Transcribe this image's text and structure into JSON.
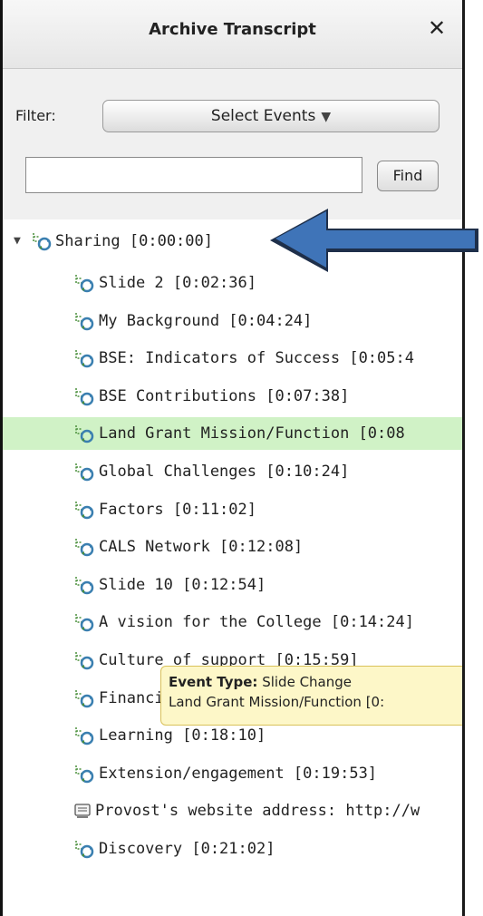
{
  "panel": {
    "title": "Archive Transcript",
    "close_icon": "close-icon"
  },
  "filter": {
    "label": "Filter:",
    "select_label": "Select Events",
    "select_arrow": "▼"
  },
  "search": {
    "value": "",
    "placeholder": "",
    "find_label": "Find"
  },
  "tree": {
    "root": {
      "label": "Sharing [0:00:00]",
      "expanded": true,
      "toggle_glyph": "▼"
    },
    "items": [
      {
        "label": "Slide 2 [0:02:36]",
        "icon": "slide-change-icon"
      },
      {
        "label": "My Background [0:04:24]",
        "icon": "slide-change-icon"
      },
      {
        "label": "BSE: Indicators of Success [0:05:4",
        "icon": "slide-change-icon"
      },
      {
        "label": "BSE Contributions [0:07:38]",
        "icon": "slide-change-icon"
      },
      {
        "label": "Land Grant Mission/Function [0:08",
        "icon": "slide-change-icon",
        "selected": true
      },
      {
        "label": "Global Challenges [0:10:24]",
        "icon": "slide-change-icon"
      },
      {
        "label": "Factors [0:11:02]",
        "icon": "slide-change-icon"
      },
      {
        "label": "CALS Network [0:12:08]",
        "icon": "slide-change-icon"
      },
      {
        "label": "Slide 10 [0:12:54]",
        "icon": "slide-change-icon"
      },
      {
        "label": "A vision for the College [0:14:24]",
        "icon": "slide-change-icon"
      },
      {
        "label": "Culture of support [0:15:59]",
        "icon": "slide-change-icon"
      },
      {
        "label": "Financial resources [0:17:06]",
        "icon": "slide-change-icon"
      },
      {
        "label": "Learning [0:18:10]",
        "icon": "slide-change-icon"
      },
      {
        "label": "Extension/engagement [0:19:53]",
        "icon": "slide-change-icon"
      },
      {
        "label": "Provost's website address: http://w",
        "icon": "chat-message-icon"
      },
      {
        "label": "Discovery [0:21:02]",
        "icon": "slide-change-icon"
      }
    ]
  },
  "tooltip": {
    "type_label": "Event Type:",
    "type_value": "Slide Change",
    "detail": "Land Grant Mission/Function [0:"
  },
  "colors": {
    "selected_row": "#d0f2c6",
    "tooltip_bg": "#fdf7c8",
    "arrow_fill": "#3f74b8"
  }
}
